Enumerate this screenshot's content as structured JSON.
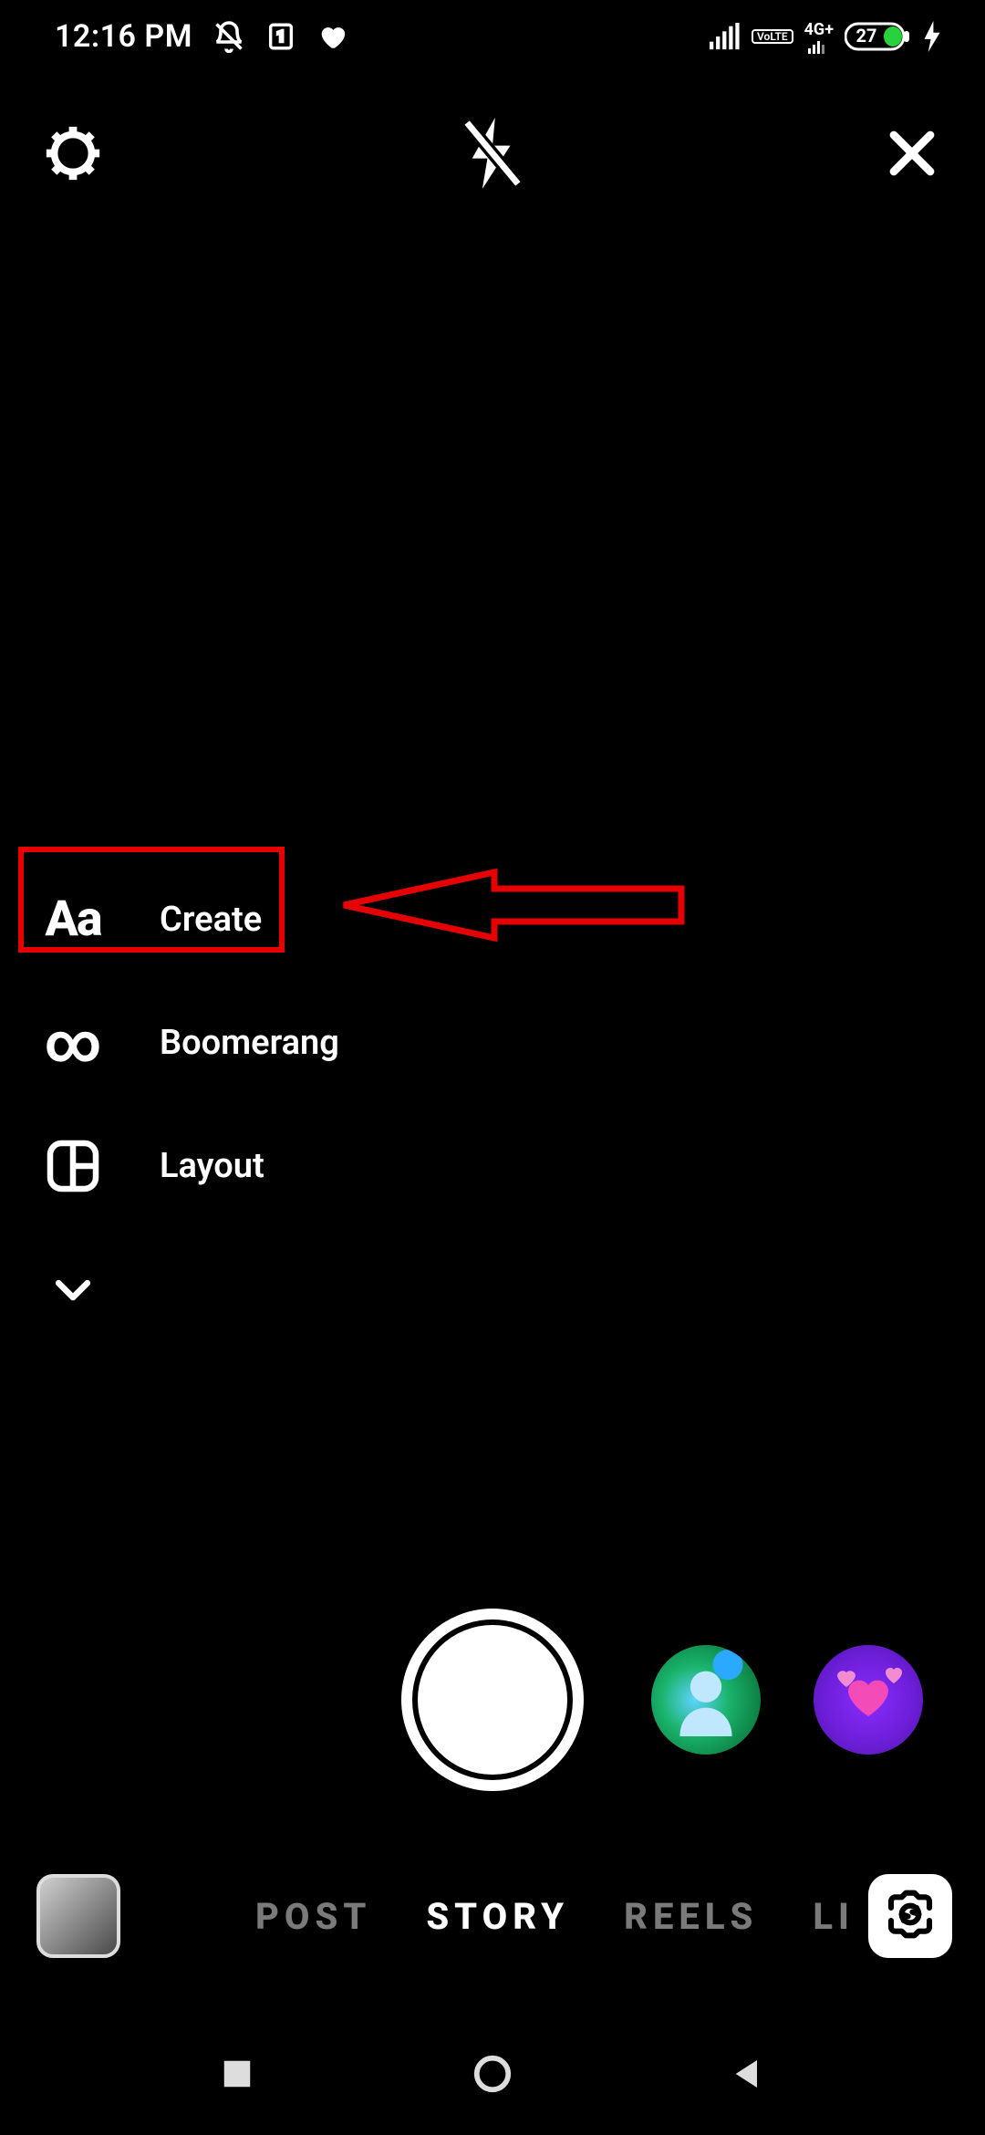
{
  "status_bar": {
    "time": "12:16 PM",
    "dnd_icon": "bell-off",
    "sim_slot": "1",
    "heart_icon": "heart",
    "signal_icon": "signal-full",
    "volte_label": "VoLTE",
    "net_label": "4G+",
    "battery_percent": "27",
    "charging": true
  },
  "camera_top": {
    "settings_icon": "gear",
    "flash_icon": "flash-off",
    "close_icon": "close"
  },
  "side_menu": {
    "items": [
      {
        "icon": "Aa",
        "label": "Create"
      },
      {
        "icon": "infinity",
        "label": "Boomerang"
      },
      {
        "icon": "layout",
        "label": "Layout"
      }
    ],
    "more_icon": "chevron-down"
  },
  "annotation": {
    "highlight_target": "create",
    "arrow_icon": "arrow-left"
  },
  "shutter": {
    "shutter_icon": "shutter",
    "effects": [
      {
        "name": "avatar-effect"
      },
      {
        "name": "hearts-effect"
      }
    ]
  },
  "mode_bar": {
    "gallery_thumb": "gallery",
    "switch_camera_icon": "camera-switch",
    "modes": [
      {
        "label": "POST",
        "active": false
      },
      {
        "label": "STORY",
        "active": true
      },
      {
        "label": "REELS",
        "active": false
      },
      {
        "label": "LIVE",
        "active": false,
        "cut": true
      }
    ]
  },
  "nav_bar": {
    "recent_icon": "square",
    "home_icon": "circle",
    "back_icon": "triangle-left"
  }
}
